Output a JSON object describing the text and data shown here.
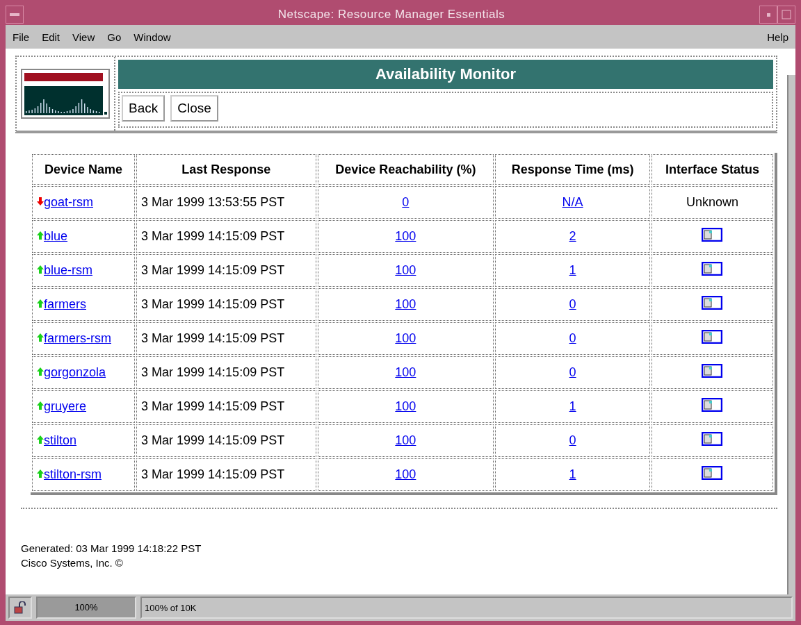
{
  "window": {
    "title": "Netscape: Resource Manager Essentials"
  },
  "menu": {
    "items": [
      "File",
      "Edit",
      "View",
      "Go",
      "Window"
    ],
    "help": "Help"
  },
  "header": {
    "title": "Availability Monitor",
    "buttons": [
      "Back",
      "Close"
    ]
  },
  "table": {
    "columns": [
      "Device Name",
      "Last Response",
      "Device Reachability (%)",
      "Response Time (ms)",
      "Interface Status"
    ],
    "rows": [
      {
        "name": "goat-rsm",
        "reachable": false,
        "last_response": "3 Mar 1999 13:53:55 PST",
        "reachability": "0",
        "response_time": "N/A",
        "interface": {
          "kind": "text",
          "text": "Unknown"
        }
      },
      {
        "name": "blue",
        "reachable": true,
        "last_response": "3 Mar 1999 14:15:09 PST",
        "reachability": "100",
        "response_time": "2",
        "interface": {
          "kind": "icon"
        }
      },
      {
        "name": "blue-rsm",
        "reachable": true,
        "last_response": "3 Mar 1999 14:15:09 PST",
        "reachability": "100",
        "response_time": "1",
        "interface": {
          "kind": "icon"
        }
      },
      {
        "name": "farmers",
        "reachable": true,
        "last_response": "3 Mar 1999 14:15:09 PST",
        "reachability": "100",
        "response_time": "0",
        "interface": {
          "kind": "icon"
        }
      },
      {
        "name": "farmers-rsm",
        "reachable": true,
        "last_response": "3 Mar 1999 14:15:09 PST",
        "reachability": "100",
        "response_time": "0",
        "interface": {
          "kind": "icon"
        }
      },
      {
        "name": "gorgonzola",
        "reachable": true,
        "last_response": "3 Mar 1999 14:15:09 PST",
        "reachability": "100",
        "response_time": "0",
        "interface": {
          "kind": "icon"
        }
      },
      {
        "name": "gruyere",
        "reachable": true,
        "last_response": "3 Mar 1999 14:15:09 PST",
        "reachability": "100",
        "response_time": "1",
        "interface": {
          "kind": "icon"
        }
      },
      {
        "name": "stilton",
        "reachable": true,
        "last_response": "3 Mar 1999 14:15:09 PST",
        "reachability": "100",
        "response_time": "0",
        "interface": {
          "kind": "icon"
        }
      },
      {
        "name": "stilton-rsm",
        "reachable": true,
        "last_response": "3 Mar 1999 14:15:09 PST",
        "reachability": "100",
        "response_time": "1",
        "interface": {
          "kind": "icon"
        }
      }
    ]
  },
  "footer": {
    "generated": "Generated: 03 Mar 1999 14:18:22 PST",
    "copyright": "Cisco Systems, Inc. ©"
  },
  "status_bar": {
    "progress": "100%",
    "level": 1,
    "message": "100% of 10K"
  }
}
